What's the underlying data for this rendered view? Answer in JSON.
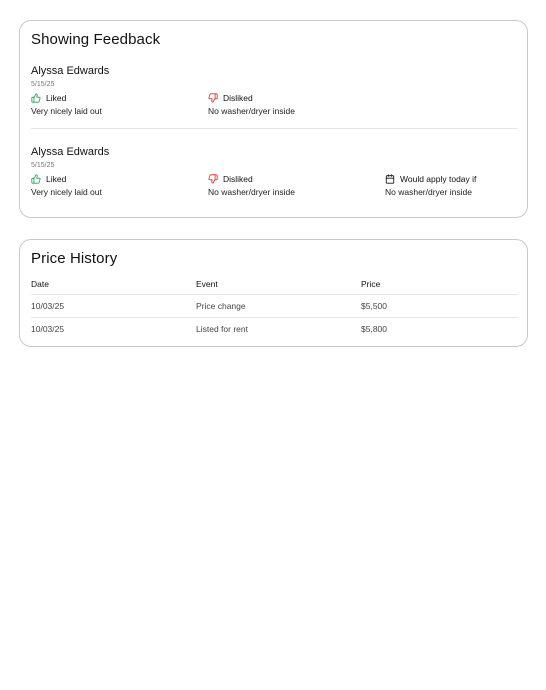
{
  "feedback": {
    "title": "Showing Feedback",
    "entries": [
      {
        "name": "Alyssa Edwards",
        "date": "5/15/25",
        "liked_label": "Liked",
        "liked_text": "Very nicely laid out",
        "disliked_label": "Disliked",
        "disliked_text": "No washer/dryer inside"
      },
      {
        "name": "Alyssa Edwards",
        "date": "5/15/25",
        "liked_label": "Liked",
        "liked_text": "Very nicely laid out",
        "disliked_label": "Disliked",
        "disliked_text": "No washer/dryer inside",
        "apply_label": "Would apply today if",
        "apply_text": "No washer/dryer inside"
      }
    ]
  },
  "price_history": {
    "title": "Price History",
    "columns": [
      "Date",
      "Event",
      "Price"
    ],
    "rows": [
      {
        "date": "10/03/25",
        "event": "Price change",
        "price": "$5,500"
      },
      {
        "date": "10/03/25",
        "event": "Listed for rent",
        "price": "$5,800"
      }
    ]
  },
  "colors": {
    "liked": "#1f9d55",
    "disliked": "#d32f2f",
    "border": "#c9c9c9"
  },
  "icons": {
    "liked": "thumbs-up-icon",
    "disliked": "thumbs-down-icon",
    "apply": "calendar-icon"
  }
}
